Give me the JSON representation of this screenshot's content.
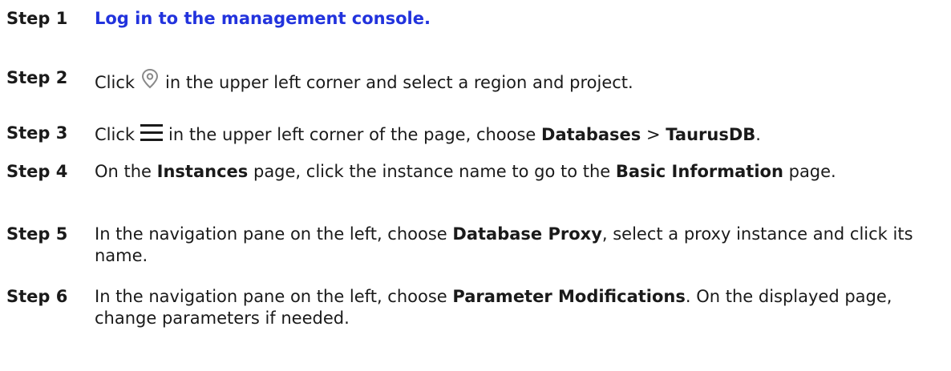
{
  "steps": [
    {
      "label": "Step 1",
      "link_text": "Log in to the management console."
    },
    {
      "label": "Step 2",
      "text_before_icon": "Click",
      "icon": "location-pin-icon",
      "text_after_icon": "in the upper left corner and select a region and project."
    },
    {
      "label": "Step 3",
      "text_before_icon": "Click",
      "icon": "hamburger-menu-icon",
      "text_after_icon": "in the upper left corner of the page, choose",
      "bold_1": "Databases",
      "separator": ">",
      "bold_2": "TaurusDB",
      "end": "."
    },
    {
      "label": "Step 4",
      "text_1": "On the",
      "bold_1": "Instances",
      "text_2": "page, click the instance name to go to the",
      "bold_2": "Basic Information",
      "text_3": "page."
    },
    {
      "label": "Step 5",
      "text_1": "In the navigation pane on the left, choose",
      "bold_1": "Database Proxy",
      "text_2": ", select a proxy instance and click its name."
    },
    {
      "label": "Step 6",
      "text_1": "In the navigation pane on the left, choose",
      "bold_1": "Parameter Modifications",
      "text_2": ". On the displayed page, change parameters if needed."
    }
  ],
  "colors": {
    "link": "#2233dd",
    "text": "#1a1a1a",
    "icon": "#8a8a8a"
  }
}
